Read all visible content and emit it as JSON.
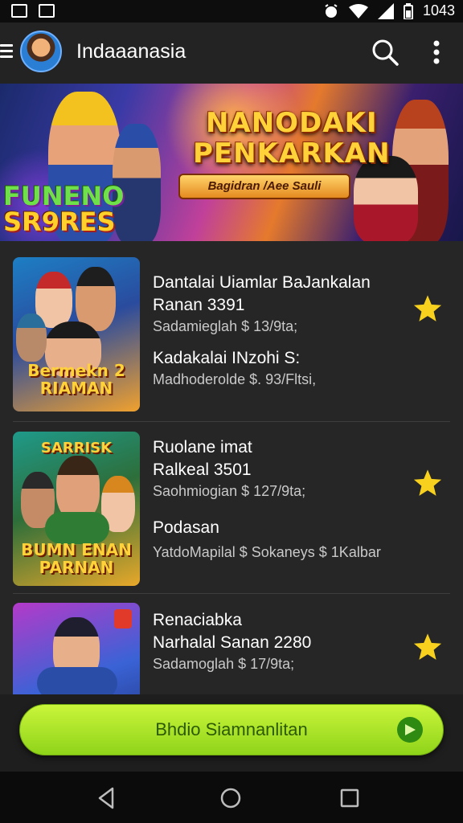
{
  "status_bar": {
    "time": "1043"
  },
  "app_bar": {
    "title": "Indaaanasia"
  },
  "banner": {
    "title_line1": "NANODAKI",
    "title_line2": "PENKARKAN",
    "ribbon": "Bagidran /Aee Sauli",
    "logo_line1": "FUNENO",
    "logo_line2": "SR9RES"
  },
  "items": [
    {
      "thumb_label": "Bermekn 2 RIAMAN",
      "line1": "Dantalai Uiamlar BaJankalan",
      "line2": "Ranan 3391",
      "line3": "Sadamieglah  $ 13/9ta;",
      "line4": "Kadakalai INzohi S:",
      "line5": "Madhoderolde  $. 93/Fltsi,"
    },
    {
      "thumb_label": "BUMN ENAN PARNAN",
      "thumb_top_label": "SARRISK",
      "line1": "Ruolane imat",
      "line2": "Ralkeal 3501",
      "line3": "Saohmiogian  $ 127/9ta;",
      "line4": "Podasan",
      "line5": "YatdoMapilal  $  Sokaneys $ 1Kalbar"
    },
    {
      "thumb_label": "",
      "line1": "Renaciabka",
      "line2": "Narhalal Sanan 2280",
      "line3": "Sadamoglah  $ 17/9ta;"
    }
  ],
  "cta": {
    "label": "Bhdio Siamnanlitan"
  },
  "colors": {
    "accent": "#a6e22a",
    "star": "#f7d11e",
    "background": "#262626"
  }
}
